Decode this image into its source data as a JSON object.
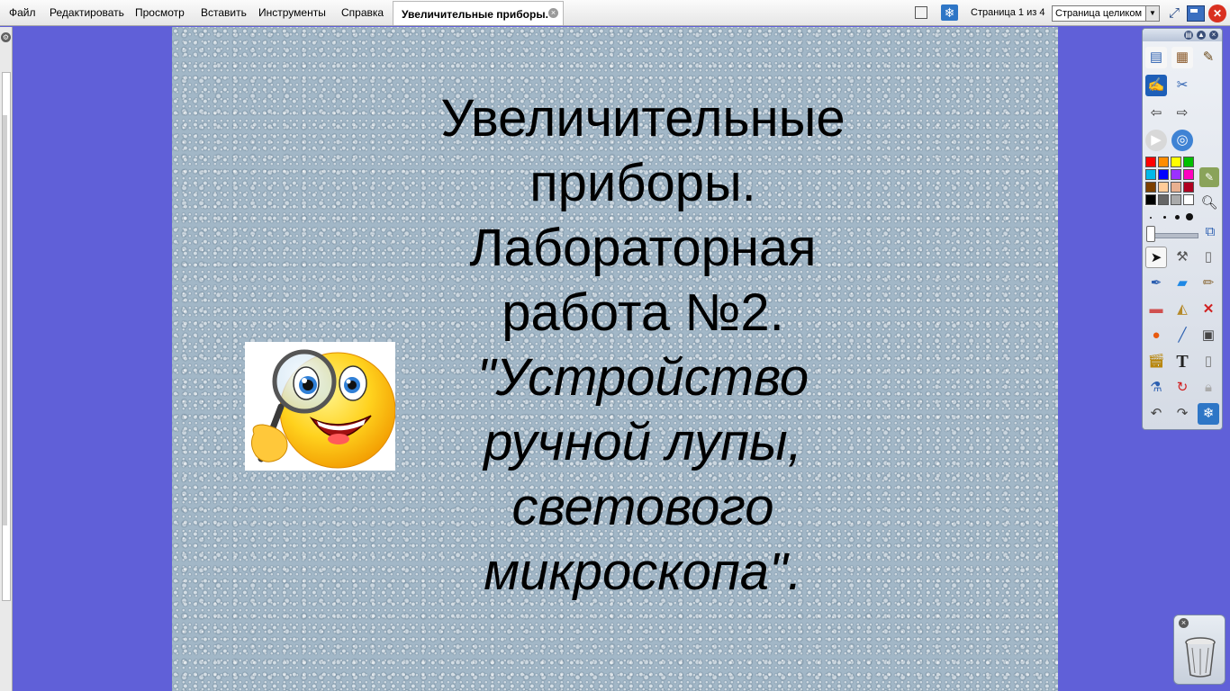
{
  "menu": {
    "items": [
      "Файл",
      "Редактировать",
      "Просмотр",
      "Вставить",
      "Инструменты",
      "Справка"
    ]
  },
  "document_tab": {
    "title": "Увеличительные приборы.",
    "close_icon": "close-icon"
  },
  "page_nav": {
    "counter": "Страница 1 из 4",
    "zoom_value": "Страница целиком"
  },
  "slide": {
    "title_lines": [
      "Увеличительные",
      "приборы.",
      "Лабораторная",
      "работа №2."
    ],
    "subtitle_lines": [
      "\"Устройство",
      "ручной лупы,",
      "светового",
      "микроскопа\"."
    ]
  },
  "icons": {
    "view": "page-view-icon",
    "snow": "snowflake-icon",
    "expand": "expand-icon",
    "window": "window-mode-icon",
    "close": "close-app-icon",
    "trash": "trash-bin-icon",
    "smiley": "magnifier-smiley-picture"
  },
  "colors": {
    "background": "#6060d8",
    "slide": "#a2b7c7",
    "accent": "#2e76c6",
    "close": "#d93020"
  },
  "palette": [
    "#ff0000",
    "#ff8c00",
    "#ffff00",
    "#00c000",
    "#00b8e8",
    "#0000ff",
    "#9b30ff",
    "#ff00c0",
    "#7b3f00",
    "#ffcc99",
    "#e8b090",
    "#b00020",
    "#000000",
    "#666666",
    "#aaaaaa",
    "#ffffff"
  ]
}
